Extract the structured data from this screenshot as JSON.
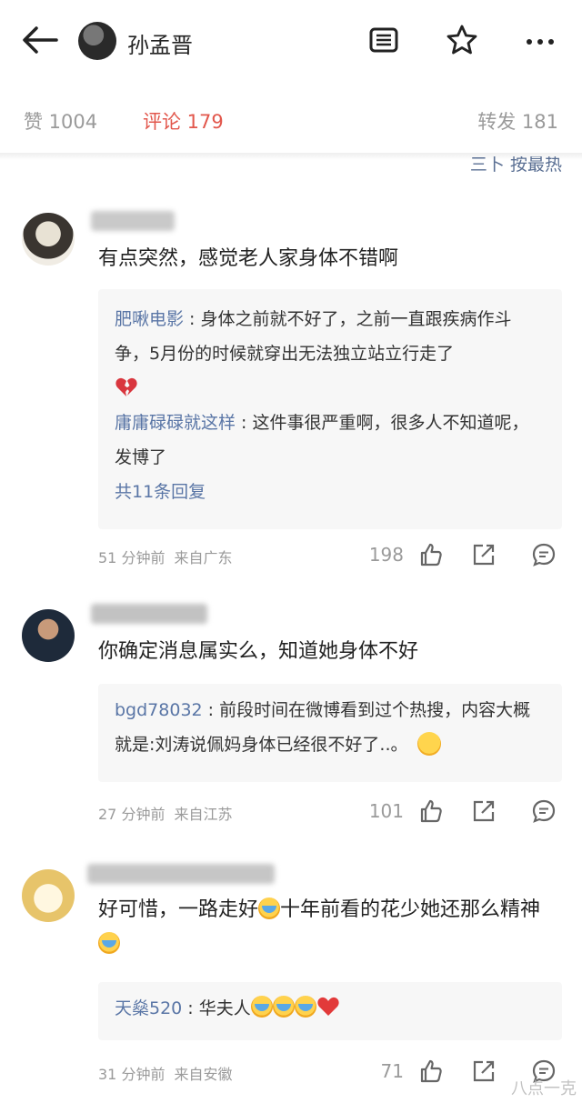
{
  "header": {
    "name": "孙孟晋"
  },
  "stats": {
    "like": "赞 1004",
    "comment": "评论 179",
    "repost": "转发 181"
  },
  "sort": {
    "label": "按最热",
    "prefix": "三卜"
  },
  "comments": [
    {
      "text": "有点突然，感觉老人家身体不错啊",
      "replies": [
        {
          "user": "肥啾电影",
          "text": "身体之前就不好了，之前一直跟疾病作斗争，5月份的时候就穿出无法独立站立行走了"
        },
        {
          "user": "庸庸碌碌就这样",
          "text": "这件事很严重啊，很多人不知道呢，发博了"
        }
      ],
      "more": "共11条回复",
      "time": "51 分钟前",
      "location": "来自广东",
      "likes": "198"
    },
    {
      "text": "你确定消息属实么，知道她身体不好",
      "replies": [
        {
          "user": "bgd78032",
          "text": "前段时间在微博看到过个热搜，内容大概就是:刘涛说佩妈身体已经很不好了..。"
        }
      ],
      "time": "27 分钟前",
      "location": "来自江苏",
      "likes": "101"
    },
    {
      "text_a": "好可惜，一路走好",
      "text_b": "十年前看的花少她还那么精神",
      "replies": [
        {
          "user": "天燊520",
          "text": "华夫人"
        }
      ],
      "time": "31 分钟前",
      "location": "来自安徽",
      "likes": "71"
    }
  ],
  "watermark": "八点一克",
  "colors": {
    "accent": "#e2574c",
    "link": "#5a76a6",
    "muted": "#9a9a9a"
  }
}
